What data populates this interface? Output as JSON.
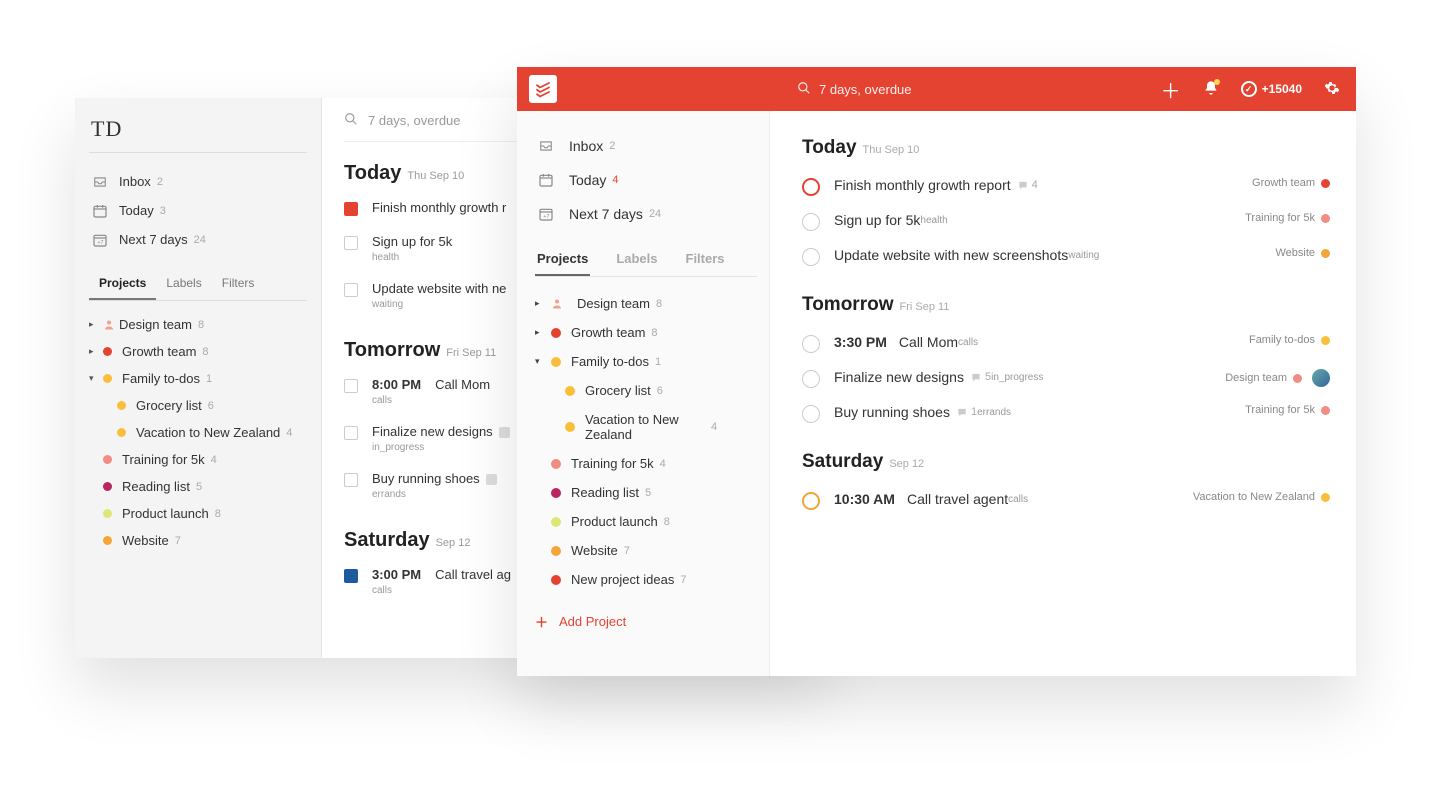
{
  "colors": {
    "accent": "#e44332",
    "yellow": "#f9bf3b",
    "orange": "#f4a538",
    "salmon": "#f28b82",
    "crimson": "#b8255f",
    "lime": "#dce775",
    "blue": "#1d5a9e",
    "person": "#f4a08b"
  },
  "search": "7 days, overdue",
  "old": {
    "logo": "TD",
    "nav": [
      {
        "label": "Inbox",
        "count": "2"
      },
      {
        "label": "Today",
        "count": "3"
      },
      {
        "label": "Next 7 days",
        "count": "24"
      }
    ],
    "tabs": [
      "Projects",
      "Labels",
      "Filters"
    ],
    "projects": [
      {
        "exp": "▸",
        "color": "#f4a08b",
        "label": "Design team",
        "count": "8",
        "icon": "person"
      },
      {
        "exp": "▸",
        "color": "#e44332",
        "label": "Growth team",
        "count": "8"
      },
      {
        "exp": "▾",
        "color": "#f9bf3b",
        "label": "Family to-dos",
        "count": "1"
      },
      {
        "child": true,
        "color": "#f9bf3b",
        "label": "Grocery list",
        "count": "6"
      },
      {
        "child": true,
        "color": "#f9bf3b",
        "label": "Vacation to New Zealand",
        "count": "4"
      },
      {
        "color": "#f28b82",
        "label": "Training for 5k",
        "count": "4"
      },
      {
        "color": "#b8255f",
        "label": "Reading list",
        "count": "5"
      },
      {
        "color": "#dce775",
        "label": "Product launch",
        "count": "8"
      },
      {
        "color": "#f4a538",
        "label": "Website",
        "count": "7"
      }
    ],
    "sections": [
      {
        "title": "Today",
        "sub": "Thu Sep 10",
        "tasks": [
          {
            "cb": "red",
            "text": "Finish monthly growth r"
          },
          {
            "text": "Sign up for 5k",
            "tag": "health"
          },
          {
            "text": "Update website with ne",
            "tag": "waiting"
          }
        ]
      },
      {
        "title": "Tomorrow",
        "sub": "Fri Sep 11",
        "tasks": [
          {
            "time": "8:00 PM",
            "text": "Call Mom",
            "tag": "calls"
          },
          {
            "text": "Finalize new designs",
            "tag": "in_progress",
            "chip": true
          },
          {
            "text": "Buy running shoes",
            "tag": "errands",
            "chip": true
          }
        ]
      },
      {
        "title": "Saturday",
        "sub": "Sep 12",
        "tasks": [
          {
            "cb": "blue",
            "time": "3:00 PM",
            "text": "Call travel ag",
            "tag": "calls"
          }
        ]
      }
    ]
  },
  "new": {
    "karma": "+15040",
    "nav": [
      {
        "icon": "inbox",
        "label": "Inbox",
        "count": "2"
      },
      {
        "icon": "today",
        "label": "Today",
        "count": "4",
        "red": true
      },
      {
        "icon": "next7",
        "label": "Next 7 days",
        "count": "24"
      }
    ],
    "tabs": [
      "Projects",
      "Labels",
      "Filters"
    ],
    "projects": [
      {
        "exp": "▸",
        "color": "#f4a08b",
        "label": "Design team",
        "count": "8",
        "icon": "person"
      },
      {
        "exp": "▸",
        "color": "#e44332",
        "label": "Growth team",
        "count": "8"
      },
      {
        "exp": "▾",
        "color": "#f9bf3b",
        "label": "Family to-dos",
        "count": "1"
      },
      {
        "child": true,
        "color": "#f9bf3b",
        "label": "Grocery list",
        "count": "6"
      },
      {
        "child": true,
        "childtxt": true,
        "color": "#f9bf3b",
        "label": "Vacation to New Zealand",
        "count": "4"
      },
      {
        "color": "#f28b82",
        "label": "Training for 5k",
        "count": "4"
      },
      {
        "color": "#b8255f",
        "label": "Reading list",
        "count": "5"
      },
      {
        "color": "#dce775",
        "label": "Product launch",
        "count": "8"
      },
      {
        "color": "#f4a538",
        "label": "Website",
        "count": "7"
      },
      {
        "color": "#e44332",
        "label": "New project ideas",
        "count": "7"
      }
    ],
    "add_project": "Add Project",
    "sections": [
      {
        "title": "Today",
        "sub": "Thu Sep 10",
        "tasks": [
          {
            "pri": "p1",
            "text": "Finish monthly growth report",
            "comments": "4",
            "proj": "Growth team",
            "pcolor": "#e44332"
          },
          {
            "text": "Sign up for 5k",
            "tag": "health",
            "proj": "Training for 5k",
            "pcolor": "#f28b82"
          },
          {
            "text": "Update website with new screenshots",
            "tag": "waiting",
            "proj": "Website",
            "pcolor": "#f4a538"
          }
        ]
      },
      {
        "title": "Tomorrow",
        "sub": "Fri Sep 11",
        "tasks": [
          {
            "time": "3:30 PM",
            "text": "Call Mom",
            "tag": "calls",
            "proj": "Family to-dos",
            "pcolor": "#f9bf3b"
          },
          {
            "text": "Finalize new designs",
            "tag": "in_progress",
            "comments": "5",
            "proj": "Design team",
            "pcolor": "#f28b82",
            "avatar": true
          },
          {
            "text": "Buy running shoes",
            "tag": "errands",
            "comments": "1",
            "proj": "Training for 5k",
            "pcolor": "#f28b82"
          }
        ]
      },
      {
        "title": "Saturday",
        "sub": "Sep 12",
        "tasks": [
          {
            "pri": "p2",
            "time": "10:30 AM",
            "text": "Call travel agent",
            "tag": "calls",
            "proj": "Vacation to New Zealand",
            "pcolor": "#f9bf3b"
          }
        ]
      }
    ]
  }
}
